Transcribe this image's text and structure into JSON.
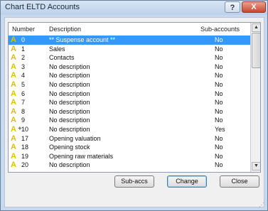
{
  "window": {
    "title": "Chart ELTD Accounts",
    "help_label": "?",
    "close_label": "X"
  },
  "columns": {
    "number": "Number",
    "description": "Description",
    "sub": "Sub-accounts"
  },
  "rows": [
    {
      "plus": "",
      "num": "0",
      "desc": "** Suspense account **",
      "sub": "No"
    },
    {
      "plus": "",
      "num": "1",
      "desc": "Sales",
      "sub": "No"
    },
    {
      "plus": "",
      "num": "2",
      "desc": "Contacts",
      "sub": "No"
    },
    {
      "plus": "",
      "num": "3",
      "desc": "No description",
      "sub": "No"
    },
    {
      "plus": "",
      "num": "4",
      "desc": "No description",
      "sub": "No"
    },
    {
      "plus": "",
      "num": "5",
      "desc": "No description",
      "sub": "No"
    },
    {
      "plus": "",
      "num": "6",
      "desc": "No description",
      "sub": "No"
    },
    {
      "plus": "",
      "num": "7",
      "desc": "No description",
      "sub": "No"
    },
    {
      "plus": "",
      "num": "8",
      "desc": "No description",
      "sub": "No"
    },
    {
      "plus": "",
      "num": "9",
      "desc": "No description",
      "sub": "No"
    },
    {
      "plus": "+",
      "num": "10",
      "desc": "No description",
      "sub": "Yes"
    },
    {
      "plus": "",
      "num": "17",
      "desc": "Opening valuation",
      "sub": "No"
    },
    {
      "plus": "",
      "num": "18",
      "desc": "Opening stock",
      "sub": "No"
    },
    {
      "plus": "",
      "num": "19",
      "desc": "Opening raw materials",
      "sub": "No"
    },
    {
      "plus": "",
      "num": "20",
      "desc": "No description",
      "sub": "No"
    }
  ],
  "selected_row": 0,
  "buttons": {
    "subaccs": "Sub-accs",
    "change": "Change",
    "close": "Close"
  },
  "colors": {
    "selection": "#3399ff",
    "icon": "#d7c200",
    "title_bar": "#c7d9ee"
  }
}
